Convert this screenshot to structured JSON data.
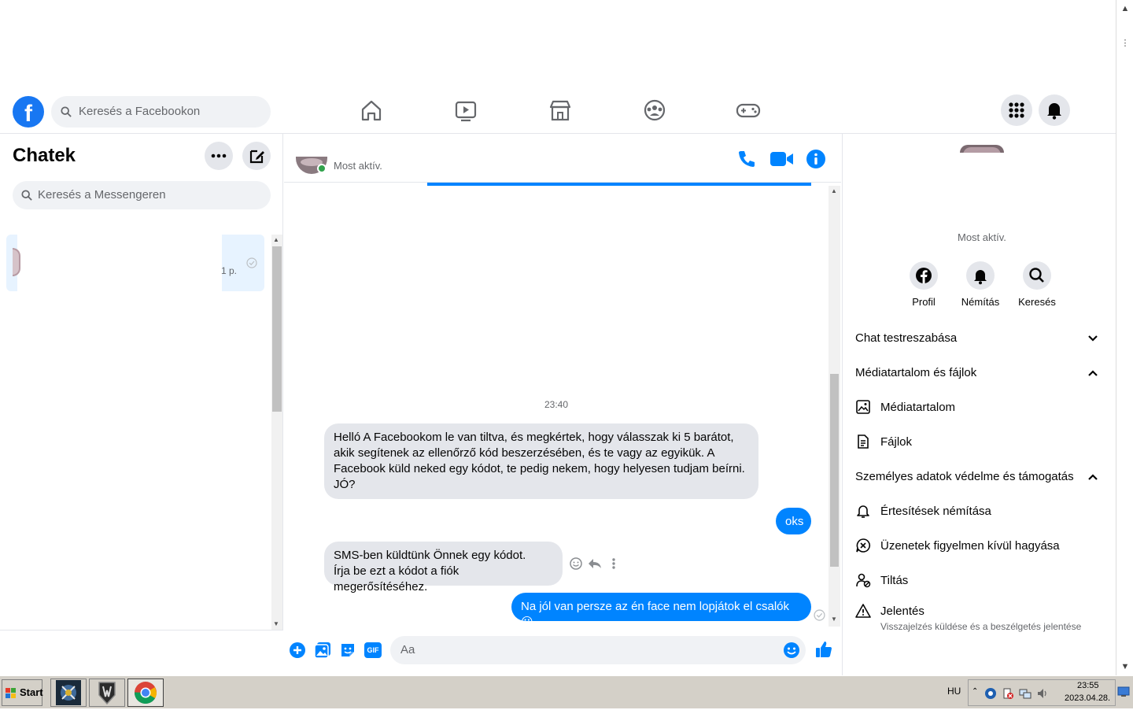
{
  "topbar": {
    "logo": "f",
    "search_placeholder": "Keresés a Facebookon",
    "nav_icons": [
      "home-icon",
      "watch-icon",
      "marketplace-icon",
      "groups-icon",
      "gaming-icon"
    ]
  },
  "left": {
    "title": "Chatek",
    "search_placeholder": "Keresés a Messengeren",
    "chats": [
      {
        "time": "1 p."
      }
    ]
  },
  "conversation": {
    "status": "Most aktív.",
    "time_separator": "23:40",
    "messages": [
      {
        "dir": "in",
        "text": "Helló A Facebookom le van tiltva, és megkértek, hogy válasszak ki 5 barátot, akik segítenek az ellenőrző kód beszerzésében, és te vagy az egyikük. A Facebook küld neked egy kódot, te pedig nekem, hogy helyesen tudjam beírni. JÓ?"
      },
      {
        "dir": "out",
        "text": "oks"
      },
      {
        "dir": "in",
        "line1": "SMS-ben küldtünk Önnek egy kódot.",
        "line2": "Írja be ezt a kódot a fiók megerősítéséhez."
      },
      {
        "dir": "out",
        "text": "Na jól van persze az én face nem lopjátok el csalók 😀"
      }
    ],
    "composer_placeholder": "Aa",
    "composer_icons": [
      "plus-icon",
      "photo-icon",
      "sticker-icon",
      "gif-icon"
    ],
    "gif_label": "GIF"
  },
  "info": {
    "status": "Most aktív.",
    "actions": [
      {
        "label": "Profil",
        "icon": "facebook-icon"
      },
      {
        "label": "Némítás",
        "icon": "bell-icon"
      },
      {
        "label": "Keresés",
        "icon": "search-icon"
      }
    ],
    "sections": {
      "customize": "Chat testreszabása",
      "media_files": "Médiatartalom és fájlok",
      "media": "Médiatartalom",
      "files": "Fájlok",
      "privacy": "Személyes adatok védelme és támogatás",
      "mute": "Értesítések némítása",
      "ignore": "Üzenetek figyelmen kívül hagyása",
      "block": "Tiltás",
      "report": "Jelentés",
      "report_sub": "Visszajelzés küldése és a beszélgetés jelentése"
    }
  },
  "taskbar": {
    "start_label": "Start",
    "lang": "HU",
    "time": "23:55",
    "date": "2023.04.28."
  },
  "colors": {
    "brand_blue": "#1877f2",
    "messenger_blue": "#0084ff",
    "active_green": "#31a24c"
  }
}
